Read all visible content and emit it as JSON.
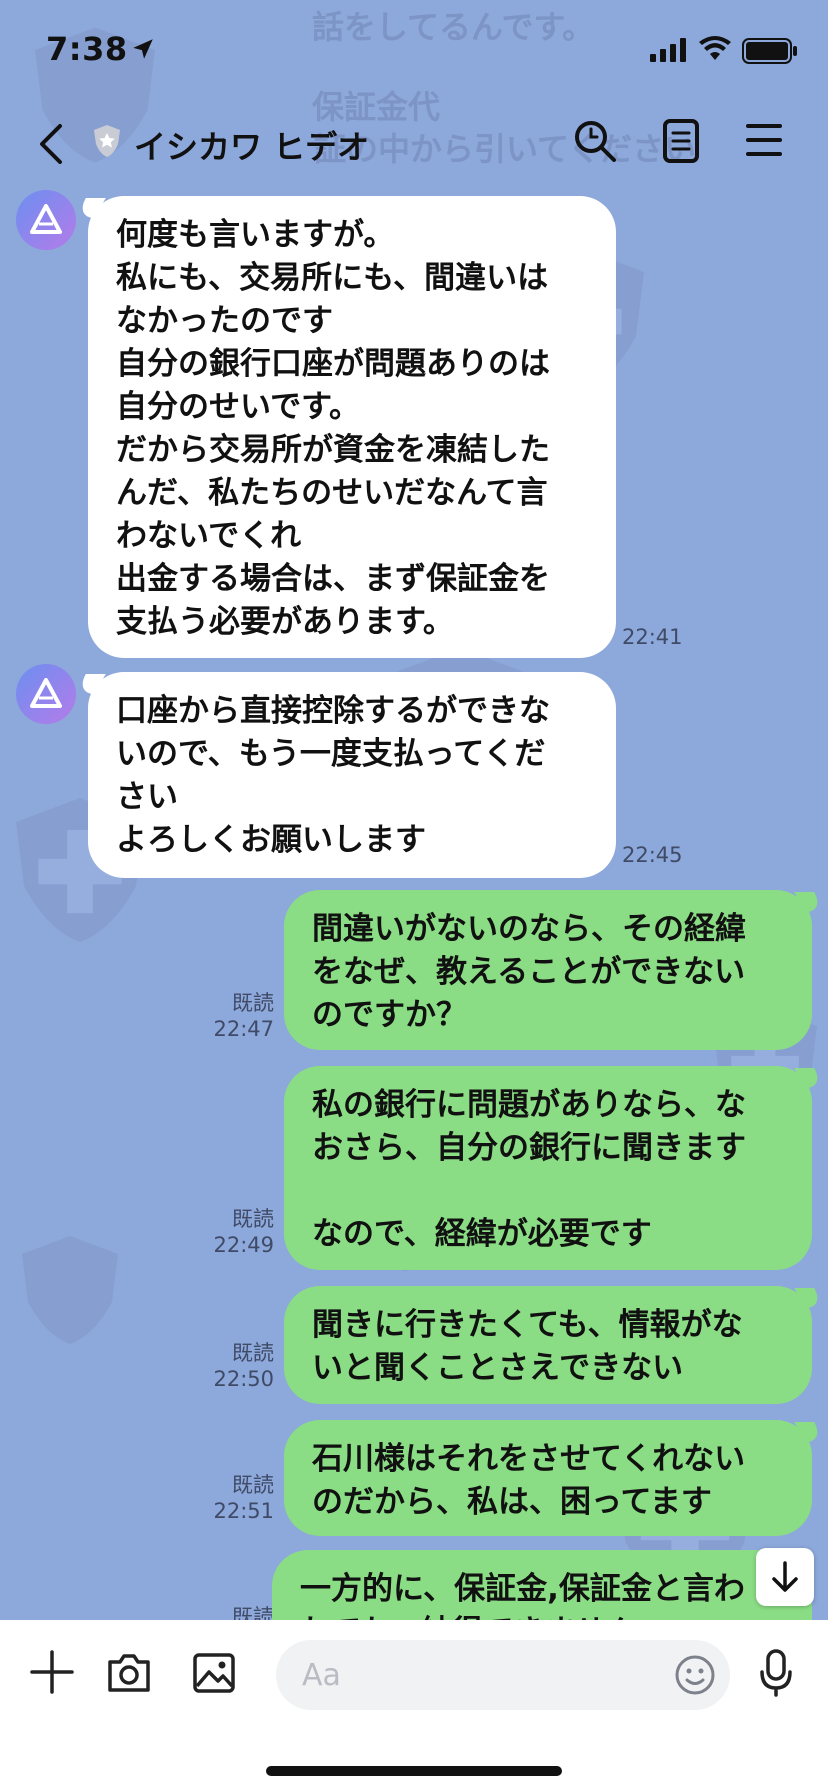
{
  "status_bar": {
    "time": "7:38"
  },
  "header": {
    "title": "イシカワ ヒデオ"
  },
  "background_overlay": {
    "line1": "話をしてるんです。",
    "line2": "保証金代",
    "line3": "　証の中から引いてください"
  },
  "messages": [
    {
      "side": "in",
      "text": "何度も言いますが。\n私にも、交易所にも、間違いは\nなかったのです\n自分の銀行口座が問題ありのは\n自分のせいです。\nだから交易所が資金を凍結した\nんだ、私たちのせいだなんて言\nわないでくれ\n出金する場合は、まず保証金を\n支払う必要があります。",
      "time": "22:41"
    },
    {
      "side": "in",
      "text": "口座から直接控除するができな\nいので、もう一度支払ってくだ\nさい\nよろしくお願いします",
      "time": "22:45"
    },
    {
      "side": "out",
      "read": "既読",
      "text": "間違いがないのなら、その経緯\nをなぜ、教えることができない\nのですか？",
      "time": "22:47"
    },
    {
      "side": "out",
      "read": "既読",
      "text": "私の銀行に問題がありなら、な\nおさら、自分の銀行に聞きます\n\nなので、経緯が必要です",
      "time": "22:49"
    },
    {
      "side": "out",
      "read": "既読",
      "text": "聞きに行きたくても、情報がな\nいと聞くことさえできない",
      "time": "22:50"
    },
    {
      "side": "out",
      "read": "既読",
      "text": "石川様はそれをさせてくれない\nのだから、私は、困ってます",
      "time": "22:51"
    },
    {
      "side": "out",
      "read": "既読",
      "text": "一方的に、保証金,保証金と言わ\nれても、納得できません",
      "time": ""
    }
  ],
  "input": {
    "placeholder": "Aa"
  },
  "colors": {
    "background": "#8da8da",
    "outgoing_bubble": "#8bdd85",
    "incoming_bubble": "#ffffff"
  }
}
